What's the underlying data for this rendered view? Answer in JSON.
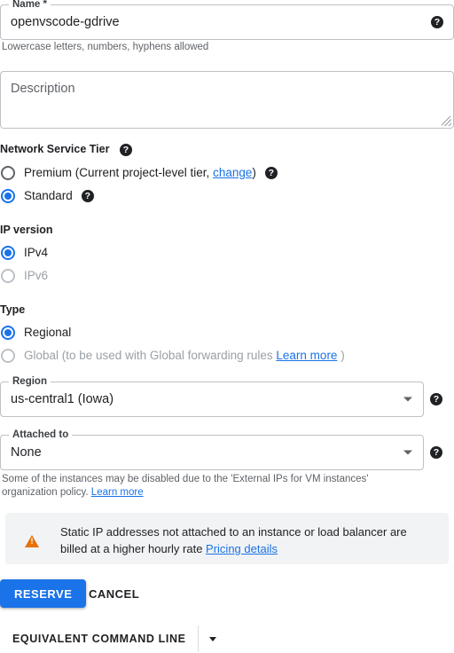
{
  "name_field": {
    "label": "Name *",
    "value": "openvscode-gdrive",
    "helper": "Lowercase letters, numbers, hyphens allowed",
    "help_icon": "help-icon"
  },
  "description_field": {
    "placeholder": "Description"
  },
  "network_service_tier": {
    "title": "Network Service Tier",
    "help_icon": "help-icon",
    "options": [
      {
        "id": "premium",
        "text_before": "Premium (Current project-level tier, ",
        "link": "change",
        "text_after": ")",
        "selected": false,
        "disabled": false,
        "has_help": true
      },
      {
        "id": "standard",
        "text_before": "Standard",
        "link": "",
        "text_after": "",
        "selected": true,
        "disabled": false,
        "has_help": true
      }
    ]
  },
  "ip_version": {
    "title": "IP version",
    "options": [
      {
        "id": "ipv4",
        "label": "IPv4",
        "selected": true,
        "disabled": false
      },
      {
        "id": "ipv6",
        "label": "IPv6",
        "selected": false,
        "disabled": true
      }
    ]
  },
  "type": {
    "title": "Type",
    "options": [
      {
        "id": "regional",
        "text_before": "Regional",
        "link": "",
        "text_after": "",
        "selected": true,
        "disabled": false
      },
      {
        "id": "global",
        "text_before": "Global (to be used with Global forwarding rules ",
        "link": "Learn more",
        "text_after": " )",
        "selected": false,
        "disabled": true
      }
    ]
  },
  "region_field": {
    "label": "Region",
    "value": "us-central1 (Iowa)",
    "help_icon": "help-icon"
  },
  "attached_to_field": {
    "label": "Attached to",
    "value": "None",
    "help_icon": "help-icon",
    "helper_text": "Some of the instances may be disabled due to the 'External IPs for VM instances' organization policy. ",
    "helper_link": "Learn more"
  },
  "warning_banner": {
    "icon": "warning-triangle-icon",
    "text": "Static IP addresses not attached to an instance or load balancer are billed at a higher hourly rate ",
    "link": "Pricing details"
  },
  "actions": {
    "reserve_label": "RESERVE",
    "cancel_label": "CANCEL"
  },
  "equivalent_command_line": {
    "label": "EQUIVALENT COMMAND LINE",
    "arrow_icon": "chevron-down-icon"
  },
  "colors": {
    "accent": "#1a73e8",
    "warning": "#e8710a",
    "banner_bg": "#f1f3f4",
    "border": "#bdc1c6",
    "muted_text": "#5f6368",
    "disabled_text": "#9aa0a6"
  }
}
